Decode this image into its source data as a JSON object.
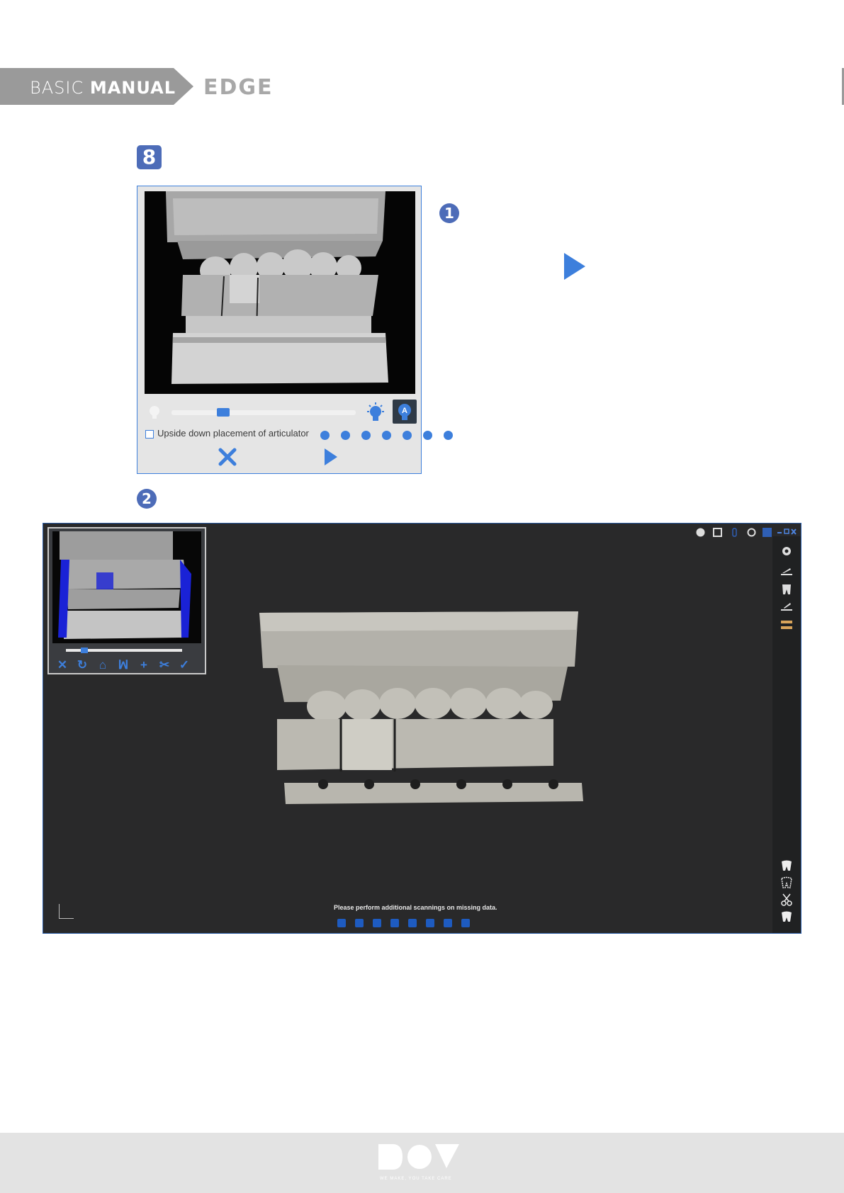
{
  "header": {
    "manual_word1": "BASIC",
    "manual_word2": "MANUAL",
    "product": "EDGE",
    "banner_color": "#9a9a9a"
  },
  "step": {
    "number": "8",
    "color": "#4d6cb8"
  },
  "callouts": {
    "first": "1",
    "second": "2"
  },
  "dialog": {
    "checkbox_label": "Upside down placement of articulator",
    "checkbox_checked": false,
    "auto_light_label": "A",
    "brightness_level": 0.28,
    "accent": "#3d7fdc"
  },
  "app": {
    "status_message": "Please perform additional scannings on missing data.",
    "background": "#29292a",
    "preview_tools": [
      "close-icon",
      "refresh-icon",
      "home-icon",
      "teeth-icon",
      "plus-icon",
      "scissors-icon",
      "check-icon"
    ],
    "top_icons": [
      "settings-circle-icon",
      "save-icon",
      "info-icon",
      "refresh-icon",
      "hand-icon"
    ],
    "rail_icons_top": [
      "gear-icon",
      "scan-lower-icon",
      "tooth-icon",
      "scan-upper-icon",
      "articulator-icon"
    ],
    "rail_icons_bottom": [
      "tooth-icon",
      "tooth-dotted-icon",
      "scissors-icon",
      "tooth-outline-icon"
    ],
    "bottom_view_buttons": 8
  },
  "footer": {
    "logo": "DOF",
    "tagline": "WE MAKE, YOU TAKE CARE",
    "background": "#e3e3e3"
  }
}
